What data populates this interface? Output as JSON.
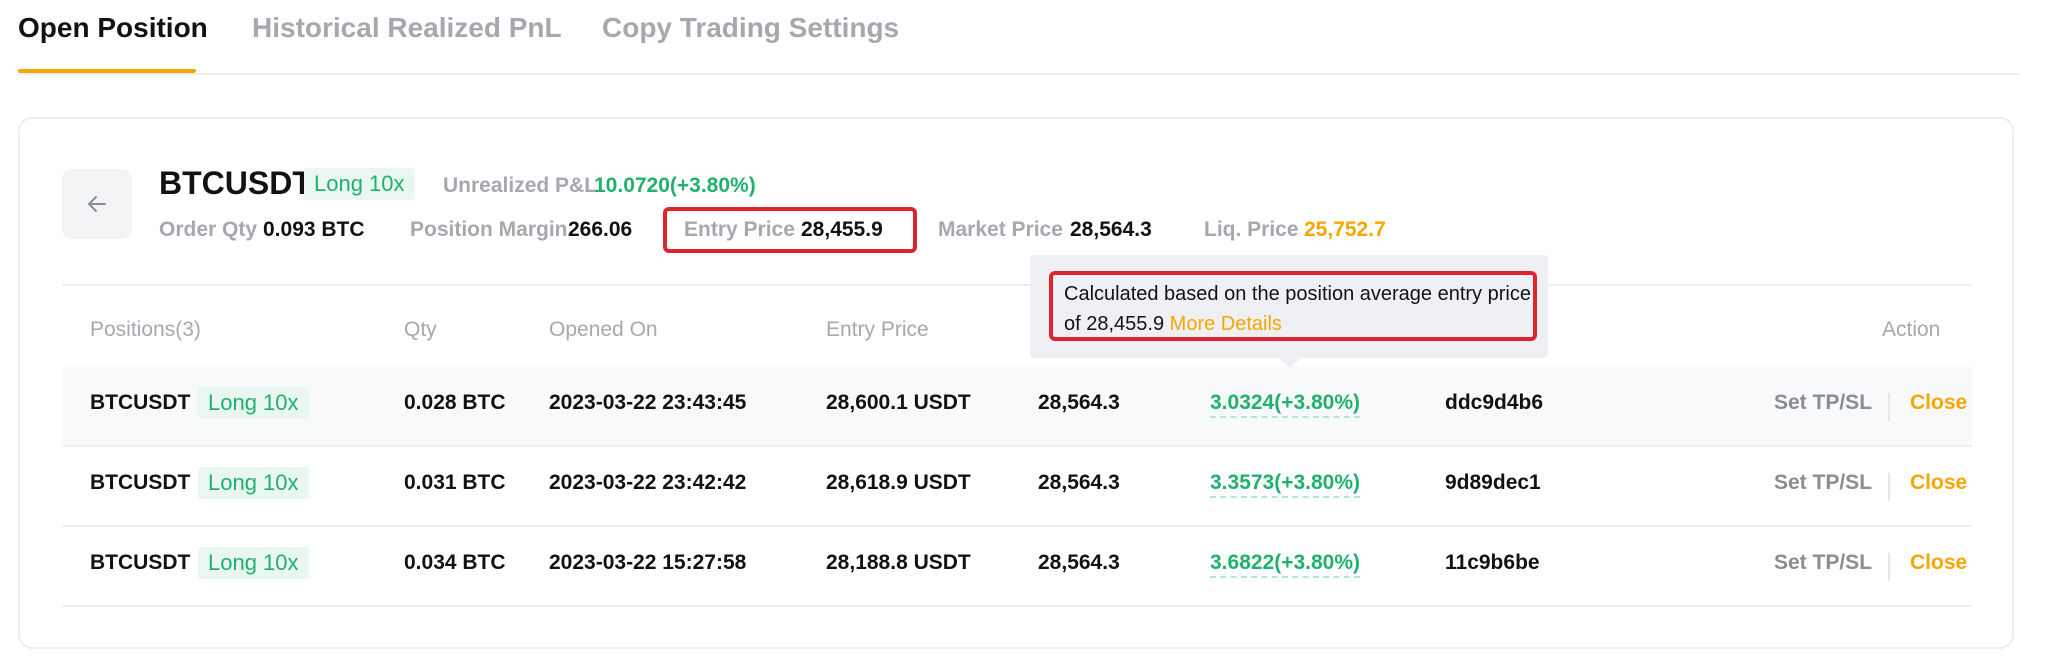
{
  "tabs": [
    {
      "label": "Open Position",
      "active": true
    },
    {
      "label": "Historical Realized PnL",
      "active": false
    },
    {
      "label": "Copy Trading Settings",
      "active": false
    }
  ],
  "position": {
    "symbol": "BTCUSDT",
    "side_badge": "Long 10x",
    "unrealized_pnl_label": "Unrealized P&L",
    "unrealized_pnl_value": "10.0720(+3.80%)",
    "order_qty_label": "Order Qty",
    "order_qty_value": "0.093 BTC",
    "position_margin_label": "Position Margin",
    "position_margin_value": "266.06",
    "entry_price_label": "Entry Price",
    "entry_price_value": "28,455.9",
    "market_price_label": "Market Price",
    "market_price_value": "28,564.3",
    "liq_price_label": "Liq. Price",
    "liq_price_value": "25,752.7"
  },
  "table": {
    "headers": {
      "positions": "Positions(3)",
      "qty": "Qty",
      "opened_on": "Opened On",
      "entry_price": "Entry Price",
      "action": "Action"
    },
    "rows": [
      {
        "symbol": "BTCUSDT",
        "badge": "Long 10x",
        "qty": "0.028 BTC",
        "opened_on": "2023-03-22 23:43:45",
        "entry_price": "28,600.1 USDT",
        "market_price": "28,564.3",
        "pnl": "3.0324(+3.80%)",
        "id": "ddc9d4b6",
        "tpsl": "Set TP/SL",
        "close": "Close"
      },
      {
        "symbol": "BTCUSDT",
        "badge": "Long 10x",
        "qty": "0.031 BTC",
        "opened_on": "2023-03-22 23:42:42",
        "entry_price": "28,618.9 USDT",
        "market_price": "28,564.3",
        "pnl": "3.3573(+3.80%)",
        "id": "9d89dec1",
        "tpsl": "Set TP/SL",
        "close": "Close"
      },
      {
        "symbol": "BTCUSDT",
        "badge": "Long 10x",
        "qty": "0.034 BTC",
        "opened_on": "2023-03-22 15:27:58",
        "entry_price": "28,188.8 USDT",
        "market_price": "28,564.3",
        "pnl": "3.6822(+3.80%)",
        "id": "11c9b6be",
        "tpsl": "Set TP/SL",
        "close": "Close"
      }
    ]
  },
  "tooltip": {
    "text": "Calculated based on the position average entry price of 28,455.9",
    "link": "More Details"
  },
  "icons": {
    "back": "arrow-left-icon"
  },
  "colors": {
    "accent": "#f7a600",
    "positive": "#20b26c",
    "highlight": "#e0242e"
  }
}
